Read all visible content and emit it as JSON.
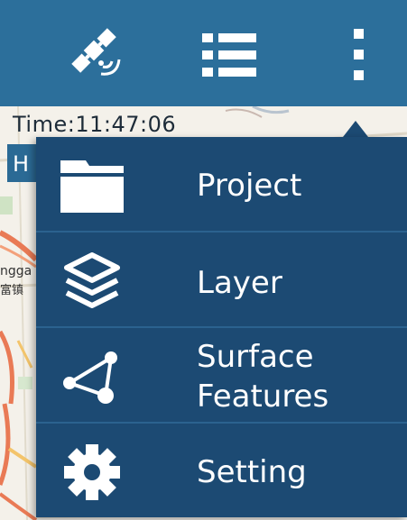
{
  "toolbar": {
    "gps_icon": "satellite-gps-icon",
    "list_icon": "list-icon",
    "more_icon": "overflow-menu-icon"
  },
  "status": {
    "time_text": "Time:11:47:06",
    "second_line": "H"
  },
  "map": {
    "labels": [
      "ngga",
      "富镇"
    ]
  },
  "menu": {
    "items": [
      {
        "label": "Project",
        "icon": "folder-icon"
      },
      {
        "label": "Layer",
        "icon": "layers-icon"
      },
      {
        "label_line1": "Surface",
        "label_line2": "Features",
        "icon": "polygon-features-icon"
      },
      {
        "label": "Setting",
        "icon": "gear-icon"
      }
    ]
  },
  "colors": {
    "toolbar_bg": "#2c6f9b",
    "menu_bg": "#1c4a73",
    "menu_divider": "#2b628f",
    "text": "#ffffff"
  }
}
